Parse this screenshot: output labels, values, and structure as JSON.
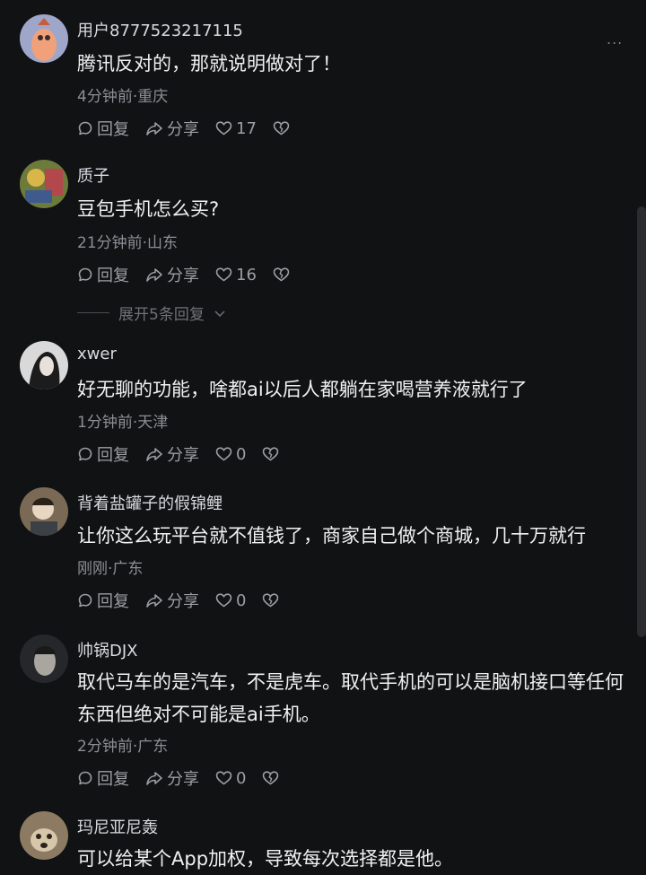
{
  "comments": [
    {
      "username": "用户8777523217115",
      "text": "腾讯反对的，那就说明做对了！",
      "meta": "4分钟前·重庆",
      "reply_label": "回复",
      "share_label": "分享",
      "likes": "17"
    },
    {
      "username": "质子",
      "text": "豆包手机怎么买?",
      "meta": "21分钟前·山东",
      "reply_label": "回复",
      "share_label": "分享",
      "likes": "16",
      "expand_label": "展开5条回复"
    },
    {
      "username": "xwer",
      "text": "好无聊的功能，啥都ai以后人都躺在家喝营养液就行了",
      "meta": "1分钟前·天津",
      "reply_label": "回复",
      "share_label": "分享",
      "likes": "0"
    },
    {
      "username": "背着盐罐子的假锦鲤",
      "text": "让你这么玩平台就不值钱了，商家自己做个商城，几十万就行",
      "meta": "刚刚·广东",
      "reply_label": "回复",
      "share_label": "分享",
      "likes": "0"
    },
    {
      "username": "帅锅DJX",
      "text": "取代马车的是汽车，不是虎车。取代手机的可以是脑机接口等任何东西但绝对不可能是ai手机。",
      "meta": "2分钟前·广东",
      "reply_label": "回复",
      "share_label": "分享",
      "likes": "0"
    },
    {
      "username": "玛尼亚尼轰",
      "text": "可以给某个App加权，导致每次选择都是他。"
    }
  ],
  "more_label": "...",
  "icons": {
    "reply": "comment-bubble-icon",
    "share": "share-arrow-icon",
    "like": "heart-icon",
    "dislike": "broken-heart-icon",
    "expand": "chevron-down-icon"
  }
}
